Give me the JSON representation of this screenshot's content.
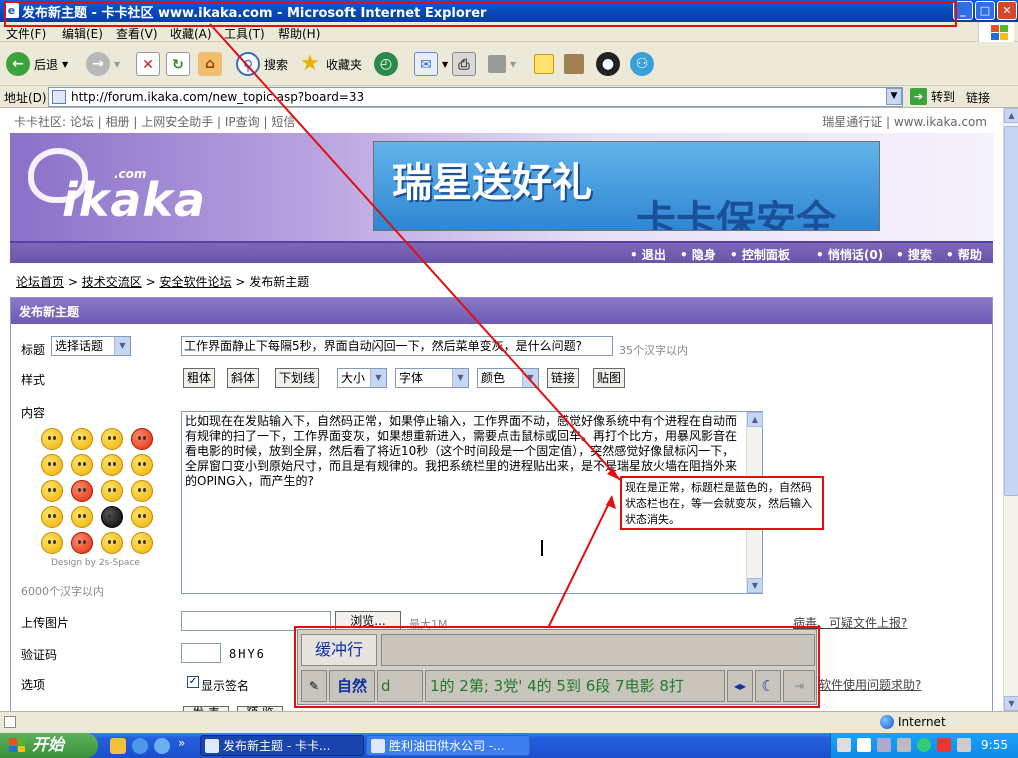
{
  "window": {
    "title": "发布新主题 - 卡卡社区 www.ikaka.com - Microsoft Internet Explorer",
    "min": "_",
    "max": "□",
    "close": "✕"
  },
  "menu": [
    "文件(F)",
    "编辑(E)",
    "查看(V)",
    "收藏(A)",
    "工具(T)",
    "帮助(H)"
  ],
  "toolbar": {
    "back": "后退",
    "search": "搜索",
    "favorites": "收藏夹"
  },
  "address": {
    "label": "地址(D)",
    "url": "http://forum.ikaka.com/new_topic.asp?board=33",
    "go": "转到",
    "links": "链接"
  },
  "site": {
    "topnav": "卡卡社区: 论坛 | 相册 | 上网安全助手 | IP查询 | 短信",
    "topnav_right": "瑞星通行证 | www.ikaka.com",
    "logo": "ikaka",
    "logo_com": ".com",
    "ad_line1": "瑞星送好礼",
    "ad_line2": "卡卡保安全",
    "nav": [
      "• 退出",
      "• 隐身",
      "• 控制面板",
      "• 悄悄话(0)",
      "• 搜索",
      "• 帮助"
    ],
    "breadcrumb": [
      "论坛首页",
      "技术交流区",
      "安全软件论坛",
      "发布新主题"
    ],
    "breadcrumb_sep": ">"
  },
  "form": {
    "header": "发布新主题",
    "title_label": "标题",
    "topic_select": "选择话题",
    "title_value": "工作界面静止下每隔5秒，界面自动闪回一下，然后菜单变灰，是什么问题?",
    "title_hint": "35个汉字以内",
    "style_label": "样式",
    "style_buttons": [
      "粗体",
      "斜体",
      "下划线"
    ],
    "size_select": "大小",
    "font_select": "字体",
    "color_select": "颜色",
    "link_btn": "链接",
    "image_btn": "贴图",
    "content_label": "内容",
    "content_text": "比如现在在发贴输入下，自然码正常，如果停止输入，工作界面不动，感觉好像系统中有个进程在自动而有规律的扫了一下，工作界面变灰，如果想重新进入，需要点击鼠标或回车。再打个比方，用暴风影音在看电影的时候，放到全屏，然后看了将近10秒（这个时间段是一个固定值），突然感觉好像鼠标闪一下，全屏窗口变小到原始尺寸，而且是有规律的。我把系统栏里的进程贴出来，是不是瑞星放火墙在阻挡外来的OPING入，而产生的?",
    "design_credit": "Design by 2s-Space",
    "content_hint": "6000个汉字以内",
    "upload_label": "上传图片",
    "browse_btn": "浏览...",
    "upload_hint": "最大1M",
    "report_link": "病毒、可疑文件上报?",
    "captcha_label": "验证码",
    "captcha_value": "8HY6",
    "options_label": "选项",
    "show_sig": "显示签名",
    "help_link": "软件使用问题求助?",
    "submit_btn": "发 表",
    "preview_btn": "预 览"
  },
  "ime": {
    "buffer_label": "缓冲行",
    "mode": "自然",
    "input": "d",
    "candidates": "1的 2第; 3党' 4的 5到 6段 7电影 8打"
  },
  "annotation": "现在是正常，标题栏是蓝色的，自然码状态栏也在，等一会就变灰，然后输入状态消失。",
  "status": {
    "zone": "Internet"
  },
  "taskbar": {
    "start": "开始",
    "tasks": [
      "发布新主题 - 卡卡...",
      "胜利油田供水公司 -..."
    ],
    "clock": "9:55"
  }
}
